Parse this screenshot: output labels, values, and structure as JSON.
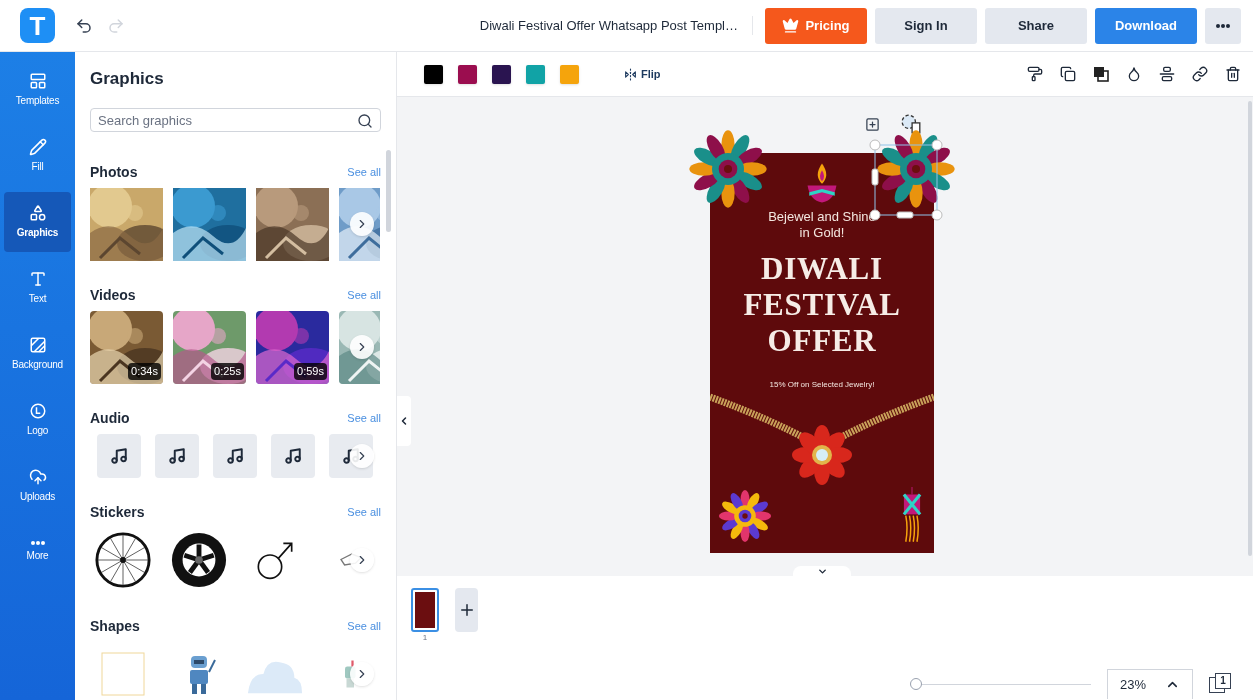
{
  "app_bar": {
    "logo": "T",
    "document_title": "Diwali Festival Offer Whatsapp Post Templ…",
    "buttons": [
      {
        "label": "Pricing",
        "kind": "pricing"
      },
      {
        "label": "Sign In",
        "kind": "secondary"
      },
      {
        "label": "Share",
        "kind": "secondary"
      },
      {
        "label": "Download",
        "kind": "primary"
      }
    ]
  },
  "history": {
    "undo_disabled": false,
    "redo_disabled": true
  },
  "sidebar": {
    "items": [
      {
        "label": "Templates",
        "selected": false
      },
      {
        "label": "Fill",
        "selected": false
      },
      {
        "label": "Graphics",
        "selected": true
      },
      {
        "label": "Text",
        "selected": false
      },
      {
        "label": "Background",
        "selected": false
      },
      {
        "label": "Logo",
        "selected": false
      },
      {
        "label": "Uploads",
        "selected": false
      },
      {
        "label": "More",
        "selected": false
      }
    ]
  },
  "panel": {
    "title": "Graphics",
    "search": {
      "placeholder": "Search graphics"
    },
    "sections": [
      {
        "title": "Photos",
        "link": "See all",
        "kind": "photos",
        "items": [
          {
            "kind": "picture"
          },
          {
            "kind": "picture"
          },
          {
            "kind": "picture"
          },
          {
            "kind": "picture"
          }
        ]
      },
      {
        "title": "Videos",
        "link": "See all",
        "kind": "videos",
        "items": [
          {
            "kind": "picture",
            "duration": "0:34s"
          },
          {
            "kind": "picture",
            "duration": "0:25s"
          },
          {
            "kind": "picture",
            "duration": "0:59s"
          },
          {
            "kind": "picture"
          }
        ]
      },
      {
        "title": "Audio",
        "link": "See all",
        "kind": "audio",
        "items": [
          {
            "kind": "track"
          },
          {
            "kind": "track"
          },
          {
            "kind": "track"
          },
          {
            "kind": "track"
          },
          {
            "kind": "track"
          }
        ]
      },
      {
        "title": "Stickers",
        "link": "See all",
        "kind": "stickers",
        "items": [
          {
            "kind": "wheel"
          },
          {
            "kind": "tire"
          },
          {
            "kind": "male-sign"
          },
          {
            "kind": "hand"
          }
        ]
      },
      {
        "title": "Shapes",
        "link": "See all",
        "kind": "shapes",
        "items": [
          {
            "kind": "frame"
          },
          {
            "kind": "robot"
          },
          {
            "kind": "cloud"
          },
          {
            "kind": "figure"
          }
        ]
      }
    ]
  },
  "toolbar": {
    "colors": [
      {
        "color": "#000000"
      },
      {
        "color": "#9b0d4f"
      },
      {
        "color": "#2a1450"
      },
      {
        "color": "#11a3a6"
      },
      {
        "color": "#f5a40c"
      }
    ],
    "flip": "Flip"
  },
  "design": {
    "tagline": "Bejewel and Shine in Gold!",
    "headline": [
      "DIWALI",
      "FESTIVAL",
      "OFFER"
    ],
    "subline": "15% Off on Selected Jewelry!"
  },
  "pages": [
    {
      "number": "1",
      "selected": true
    }
  ],
  "zoom": {
    "level": 0.03,
    "value": "23%"
  },
  "page_count": "1"
}
